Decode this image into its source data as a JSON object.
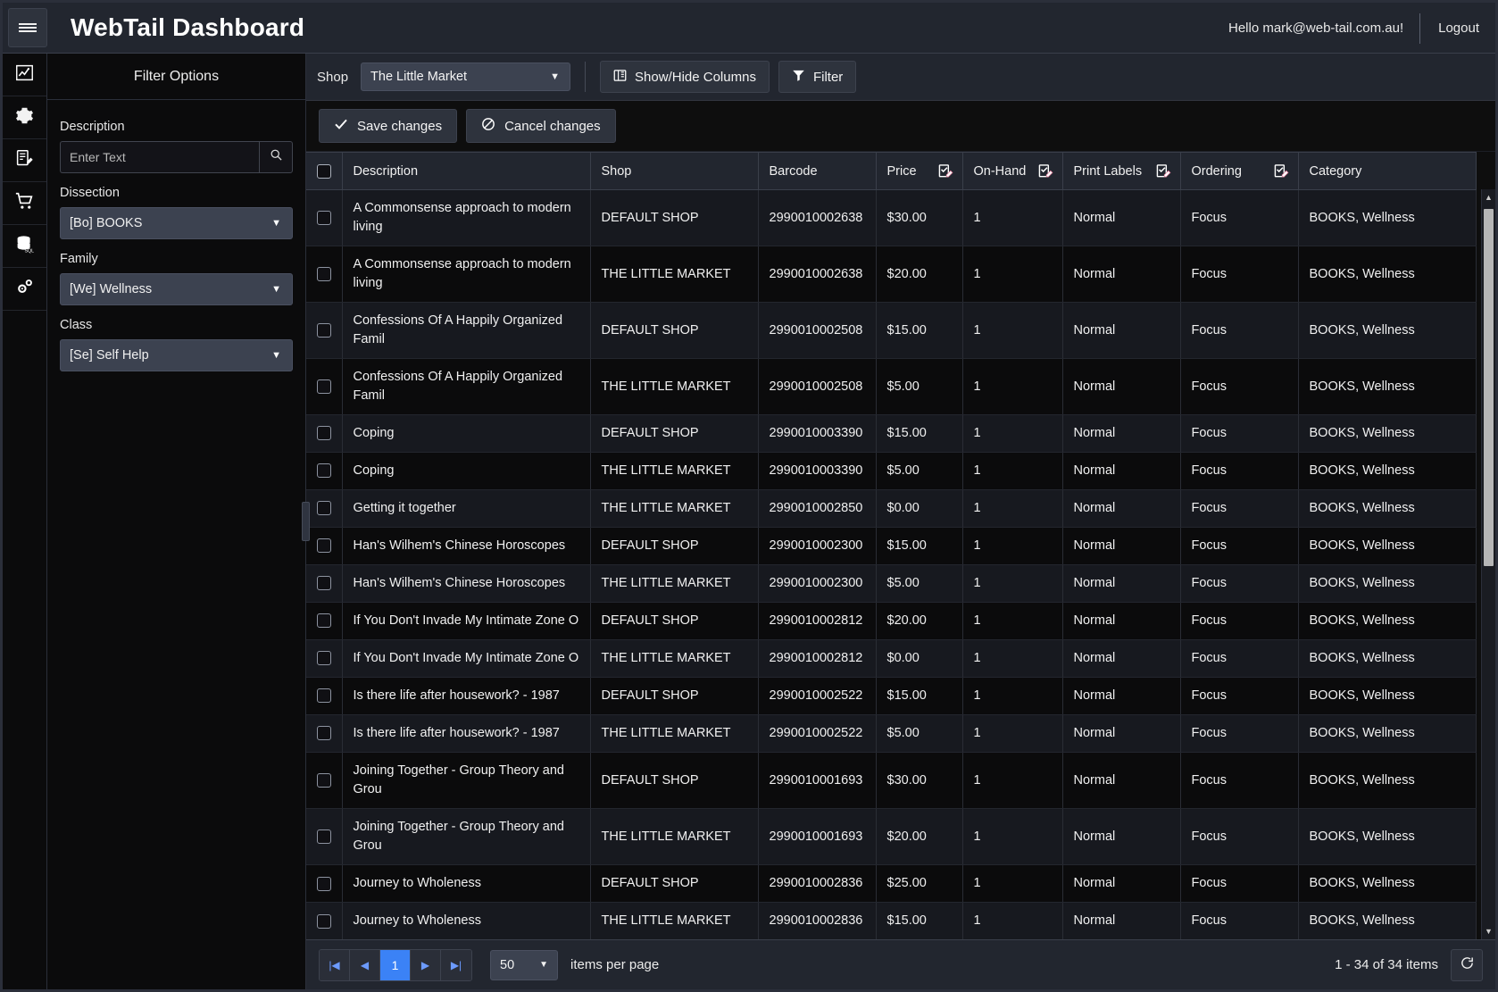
{
  "header": {
    "title": "WebTail Dashboard",
    "menu_icon": "hamburger-icon",
    "greeting": "Hello mark@web-tail.com.au!",
    "logout": "Logout"
  },
  "rail": {
    "items": [
      {
        "icon": "chart-line-icon",
        "name": "dashboard"
      },
      {
        "icon": "gear-icon",
        "name": "settings"
      },
      {
        "icon": "report-edit-icon",
        "name": "reports"
      },
      {
        "icon": "shopping-cart-icon",
        "name": "sales"
      },
      {
        "icon": "database-sql-icon",
        "name": "database"
      },
      {
        "icon": "cogs-icon",
        "name": "admin"
      }
    ]
  },
  "filter_panel": {
    "title": "Filter Options",
    "description_label": "Description",
    "description_value": "",
    "description_placeholder": "Enter Text",
    "search_icon": "magnifier-icon",
    "dissection_label": "Dissection",
    "dissection_value": "[Bo] BOOKS",
    "family_label": "Family",
    "family_value": "[We] Wellness",
    "class_label": "Class",
    "class_value": "[Se] Self Help"
  },
  "toolbar": {
    "shop_label": "Shop",
    "shop_value": "The Little Market",
    "show_hide_columns": "Show/Hide Columns",
    "filter": "Filter",
    "save_changes": "Save changes",
    "cancel_changes": "Cancel changes"
  },
  "grid": {
    "columns": [
      {
        "label": "Description",
        "edit_icon": false
      },
      {
        "label": "Shop",
        "edit_icon": false
      },
      {
        "label": "Barcode",
        "edit_icon": false
      },
      {
        "label": "Price",
        "edit_icon": true
      },
      {
        "label": "On-Hand",
        "edit_icon": true
      },
      {
        "label": "Print Labels",
        "edit_icon": true
      },
      {
        "label": "Ordering",
        "edit_icon": true
      },
      {
        "label": "Category",
        "edit_icon": false
      }
    ],
    "rows": [
      {
        "description": "A Commonsense approach to modern living",
        "shop": "DEFAULT SHOP",
        "barcode": "2990010002638",
        "price": "$30.00",
        "on_hand": "1",
        "print_labels": "Normal",
        "ordering": "Focus",
        "category": "BOOKS, Wellness"
      },
      {
        "description": "A Commonsense approach to modern living",
        "shop": "THE LITTLE MARKET",
        "barcode": "2990010002638",
        "price": "$20.00",
        "on_hand": "1",
        "print_labels": "Normal",
        "ordering": "Focus",
        "category": "BOOKS, Wellness"
      },
      {
        "description": "Confessions Of A Happily Organized Famil",
        "shop": "DEFAULT SHOP",
        "barcode": "2990010002508",
        "price": "$15.00",
        "on_hand": "1",
        "print_labels": "Normal",
        "ordering": "Focus",
        "category": "BOOKS, Wellness"
      },
      {
        "description": "Confessions Of A Happily Organized Famil",
        "shop": "THE LITTLE MARKET",
        "barcode": "2990010002508",
        "price": "$5.00",
        "on_hand": "1",
        "print_labels": "Normal",
        "ordering": "Focus",
        "category": "BOOKS, Wellness"
      },
      {
        "description": "Coping",
        "shop": "DEFAULT SHOP",
        "barcode": "2990010003390",
        "price": "$15.00",
        "on_hand": "1",
        "print_labels": "Normal",
        "ordering": "Focus",
        "category": "BOOKS, Wellness"
      },
      {
        "description": "Coping",
        "shop": "THE LITTLE MARKET",
        "barcode": "2990010003390",
        "price": "$5.00",
        "on_hand": "1",
        "print_labels": "Normal",
        "ordering": "Focus",
        "category": "BOOKS, Wellness"
      },
      {
        "description": "Getting it together",
        "shop": "THE LITTLE MARKET",
        "barcode": "2990010002850",
        "price": "$0.00",
        "on_hand": "1",
        "print_labels": "Normal",
        "ordering": "Focus",
        "category": "BOOKS, Wellness"
      },
      {
        "description": "Han's Wilhem's Chinese Horoscopes",
        "shop": "DEFAULT SHOP",
        "barcode": "2990010002300",
        "price": "$15.00",
        "on_hand": "1",
        "print_labels": "Normal",
        "ordering": "Focus",
        "category": "BOOKS, Wellness"
      },
      {
        "description": "Han's Wilhem's Chinese Horoscopes",
        "shop": "THE LITTLE MARKET",
        "barcode": "2990010002300",
        "price": "$5.00",
        "on_hand": "1",
        "print_labels": "Normal",
        "ordering": "Focus",
        "category": "BOOKS, Wellness"
      },
      {
        "description": "If You Don't Invade My Intimate Zone O",
        "shop": "DEFAULT SHOP",
        "barcode": "2990010002812",
        "price": "$20.00",
        "on_hand": "1",
        "print_labels": "Normal",
        "ordering": "Focus",
        "category": "BOOKS, Wellness"
      },
      {
        "description": "If You Don't Invade My Intimate Zone O",
        "shop": "THE LITTLE MARKET",
        "barcode": "2990010002812",
        "price": "$0.00",
        "on_hand": "1",
        "print_labels": "Normal",
        "ordering": "Focus",
        "category": "BOOKS, Wellness"
      },
      {
        "description": "Is there life after housework? - 1987",
        "shop": "DEFAULT SHOP",
        "barcode": "2990010002522",
        "price": "$15.00",
        "on_hand": "1",
        "print_labels": "Normal",
        "ordering": "Focus",
        "category": "BOOKS, Wellness"
      },
      {
        "description": "Is there life after housework? - 1987",
        "shop": "THE LITTLE MARKET",
        "barcode": "2990010002522",
        "price": "$5.00",
        "on_hand": "1",
        "print_labels": "Normal",
        "ordering": "Focus",
        "category": "BOOKS, Wellness"
      },
      {
        "description": "Joining Together - Group Theory and Grou",
        "shop": "DEFAULT SHOP",
        "barcode": "2990010001693",
        "price": "$30.00",
        "on_hand": "1",
        "print_labels": "Normal",
        "ordering": "Focus",
        "category": "BOOKS, Wellness"
      },
      {
        "description": "Joining Together - Group Theory and Grou",
        "shop": "THE LITTLE MARKET",
        "barcode": "2990010001693",
        "price": "$20.00",
        "on_hand": "1",
        "print_labels": "Normal",
        "ordering": "Focus",
        "category": "BOOKS, Wellness"
      },
      {
        "description": "Journey to Wholeness",
        "shop": "DEFAULT SHOP",
        "barcode": "2990010002836",
        "price": "$25.00",
        "on_hand": "1",
        "print_labels": "Normal",
        "ordering": "Focus",
        "category": "BOOKS, Wellness"
      },
      {
        "description": "Journey to Wholeness",
        "shop": "THE LITTLE MARKET",
        "barcode": "2990010002836",
        "price": "$15.00",
        "on_hand": "1",
        "print_labels": "Normal",
        "ordering": "Focus",
        "category": "BOOKS, Wellness"
      }
    ]
  },
  "pager": {
    "first": "|◀",
    "prev": "◀",
    "current_page": "1",
    "next": "▶",
    "last": "▶|",
    "page_size": "50",
    "items_per_page_label": "items per page",
    "items_info": "1 - 34 of 34 items",
    "refresh_icon": "refresh-icon"
  },
  "colors": {
    "accent": "#3b82f6",
    "panel": "#22262f",
    "background": "#0e0e0e"
  }
}
